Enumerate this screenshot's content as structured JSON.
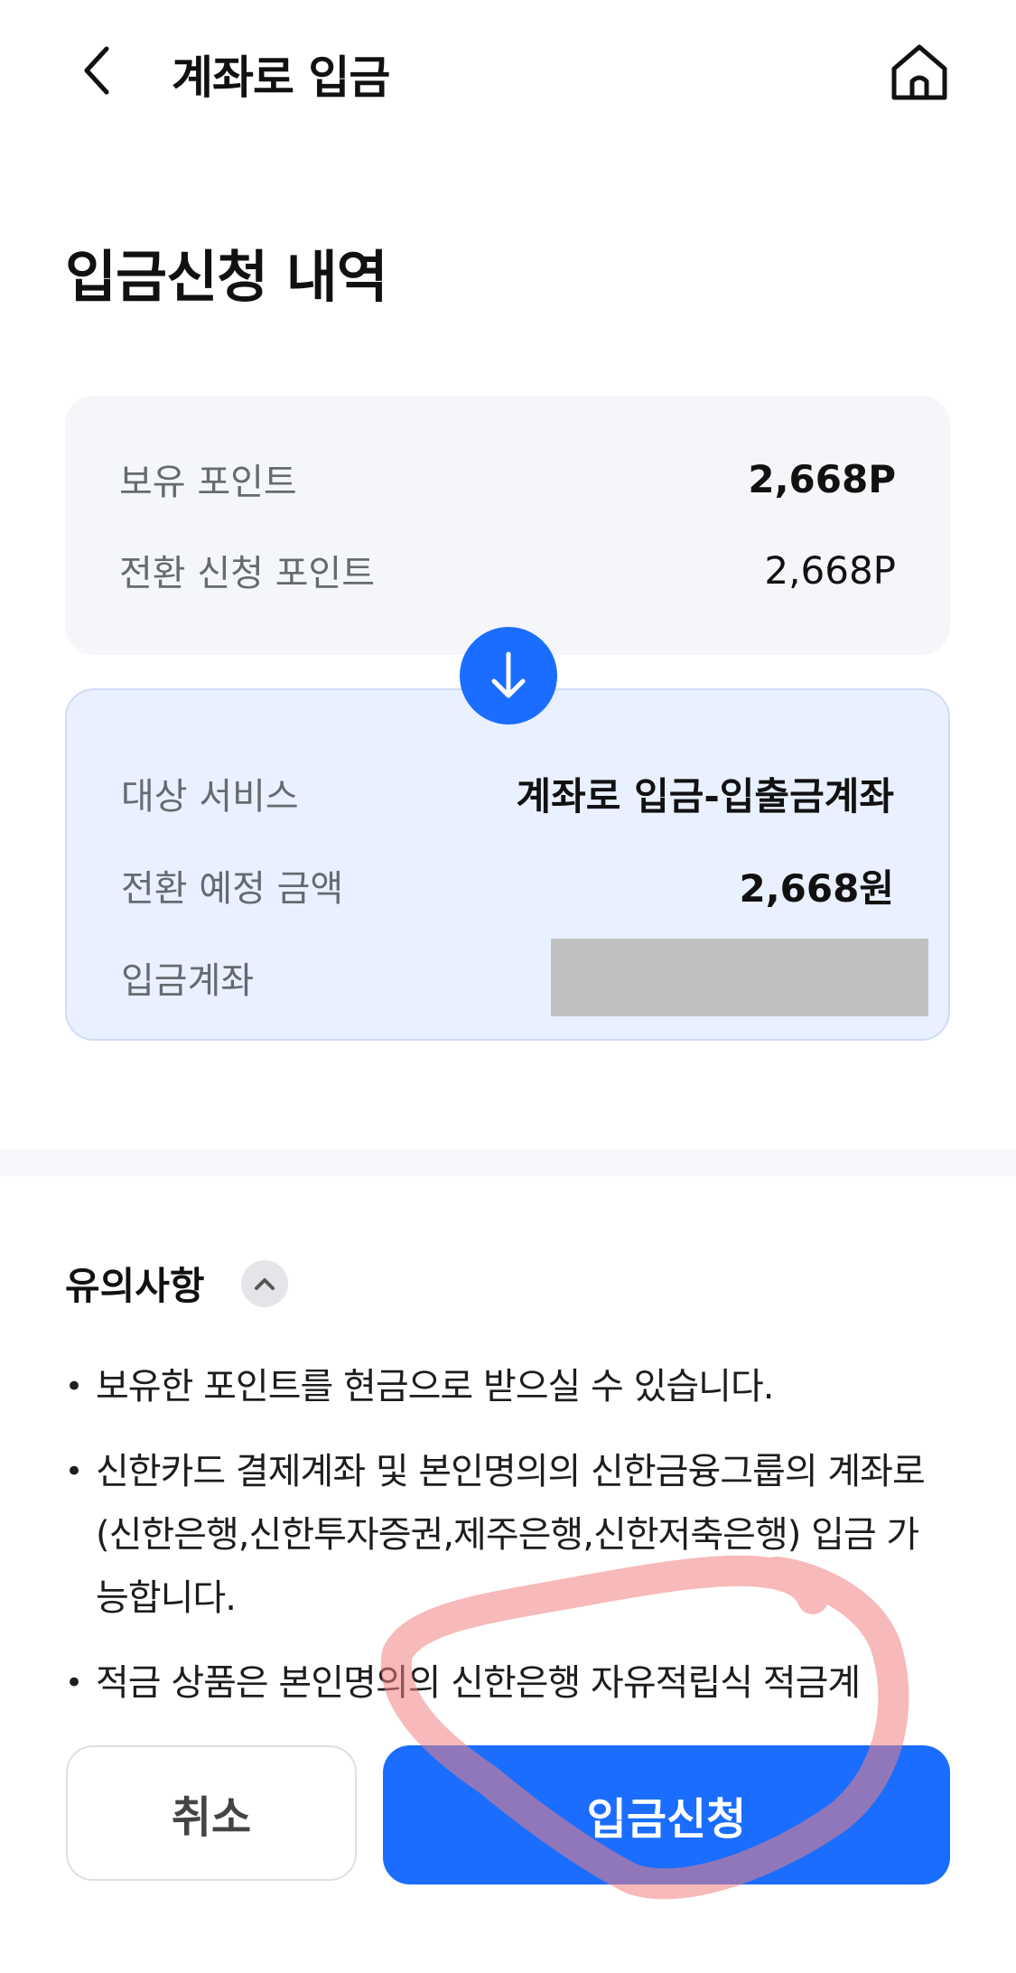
{
  "header": {
    "title": "계좌로 입금",
    "back_icon": "chevron-left-icon",
    "home_icon": "home-icon"
  },
  "page_title": "입금신청 내역",
  "points_card": {
    "held_points_label": "보유 포인트",
    "held_points_value": "2,668P",
    "request_points_label": "전환 신청 포인트",
    "request_points_value": "2,668P"
  },
  "arrow_icon": "arrow-down-icon",
  "target_card": {
    "service_label": "대상 서비스",
    "service_value": "계좌로 입금-입출금계좌",
    "amount_label": "전환 예정 금액",
    "amount_value": "2,668원",
    "account_label": "입금계좌"
  },
  "notice": {
    "title": "유의사항",
    "toggle_icon": "chevron-up-icon",
    "items": [
      "보유한 포인트를 현금으로 받으실 수 있습니다.",
      "신한카드 결제계좌 및 본인명의의 신한금융그룹의 계좌로(신한은행,신한투자증권,제주은행,신한저축은행) 입금 가능합니다.",
      "적금 상품은 본인명의의 신한은행 자유적립식 적금계"
    ]
  },
  "buttons": {
    "cancel_label": "취소",
    "submit_label": "입금신청"
  },
  "colors": {
    "accent": "#1a6dff",
    "card_gray": "#f5f6fa",
    "card_blue": "#e9f0ff",
    "annotation_stroke": "#f08080"
  }
}
